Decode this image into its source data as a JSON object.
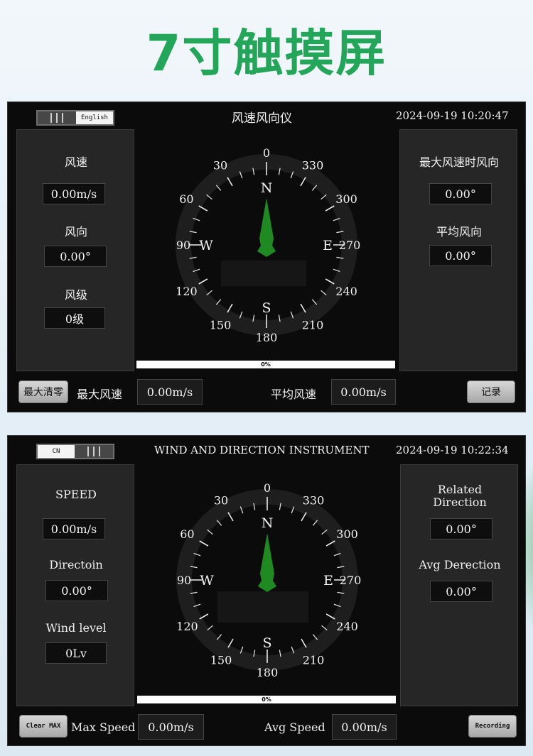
{
  "headline": "7寸触摸屏",
  "colors": {
    "accent_green": "#23a55a",
    "needle_green": "#1f8a22",
    "screen_bg": "#0b0b0b",
    "panel_bg": "#262626"
  },
  "screens": [
    {
      "toggle": {
        "lang_label": "English",
        "bars_side": "left"
      },
      "title": "风速风向仪",
      "datetime": "2024-09-19 10:20:47",
      "left_panel": {
        "speed_label": "风速",
        "speed_value": "0.00m/s",
        "direction_label": "风向",
        "direction_value": "0.00°",
        "level_label": "风级",
        "level_value": "0级"
      },
      "right_panel": {
        "max_dir_label": "最大风速时风向",
        "max_dir_value": "0.00°",
        "avg_dir_label": "平均风向",
        "avg_dir_value": "0.00°"
      },
      "compass": {
        "cardinals": {
          "n": "N",
          "s": "S",
          "e": "E",
          "w": "W"
        },
        "degree_labels": [
          "0",
          "30",
          "60",
          "90",
          "120",
          "150",
          "180",
          "210",
          "240",
          "270",
          "300",
          "330"
        ],
        "needle_direction_deg": 0
      },
      "progress": {
        "label": "0%",
        "percent": 0
      },
      "footer": {
        "clear_button": "最大清零",
        "max_speed_label": "最大风速",
        "max_speed_value": "0.00m/s",
        "avg_speed_label": "平均风速",
        "avg_speed_value": "0.00m/s",
        "record_button": "记录"
      }
    },
    {
      "toggle": {
        "lang_label": "CN",
        "bars_side": "right"
      },
      "title": "WIND AND DIRECTION INSTRUMENT",
      "datetime": "2024-09-19 10:22:34",
      "left_panel": {
        "speed_label": "SPEED",
        "speed_value": "0.00m/s",
        "direction_label": "Directoin",
        "direction_value": "0.00°",
        "level_label": "Wind level",
        "level_value": "0Lv"
      },
      "right_panel": {
        "max_dir_label_line1": "Related",
        "max_dir_label_line2": "Direction",
        "max_dir_value": "0.00°",
        "avg_dir_label": "Avg Derection",
        "avg_dir_value": "0.00°"
      },
      "compass": {
        "cardinals": {
          "n": "N",
          "s": "S",
          "e": "E",
          "w": "W"
        },
        "degree_labels": [
          "0",
          "30",
          "60",
          "90",
          "120",
          "150",
          "180",
          "210",
          "240",
          "270",
          "300",
          "330"
        ],
        "needle_direction_deg": 0
      },
      "progress": {
        "label": "0%",
        "percent": 0
      },
      "footer": {
        "clear_button": "Clear MAX",
        "max_speed_label": "Max Speed",
        "max_speed_value": "0.00m/s",
        "avg_speed_label": "Avg Speed",
        "avg_speed_value": "0.00m/s",
        "record_button": "Recording"
      }
    }
  ]
}
